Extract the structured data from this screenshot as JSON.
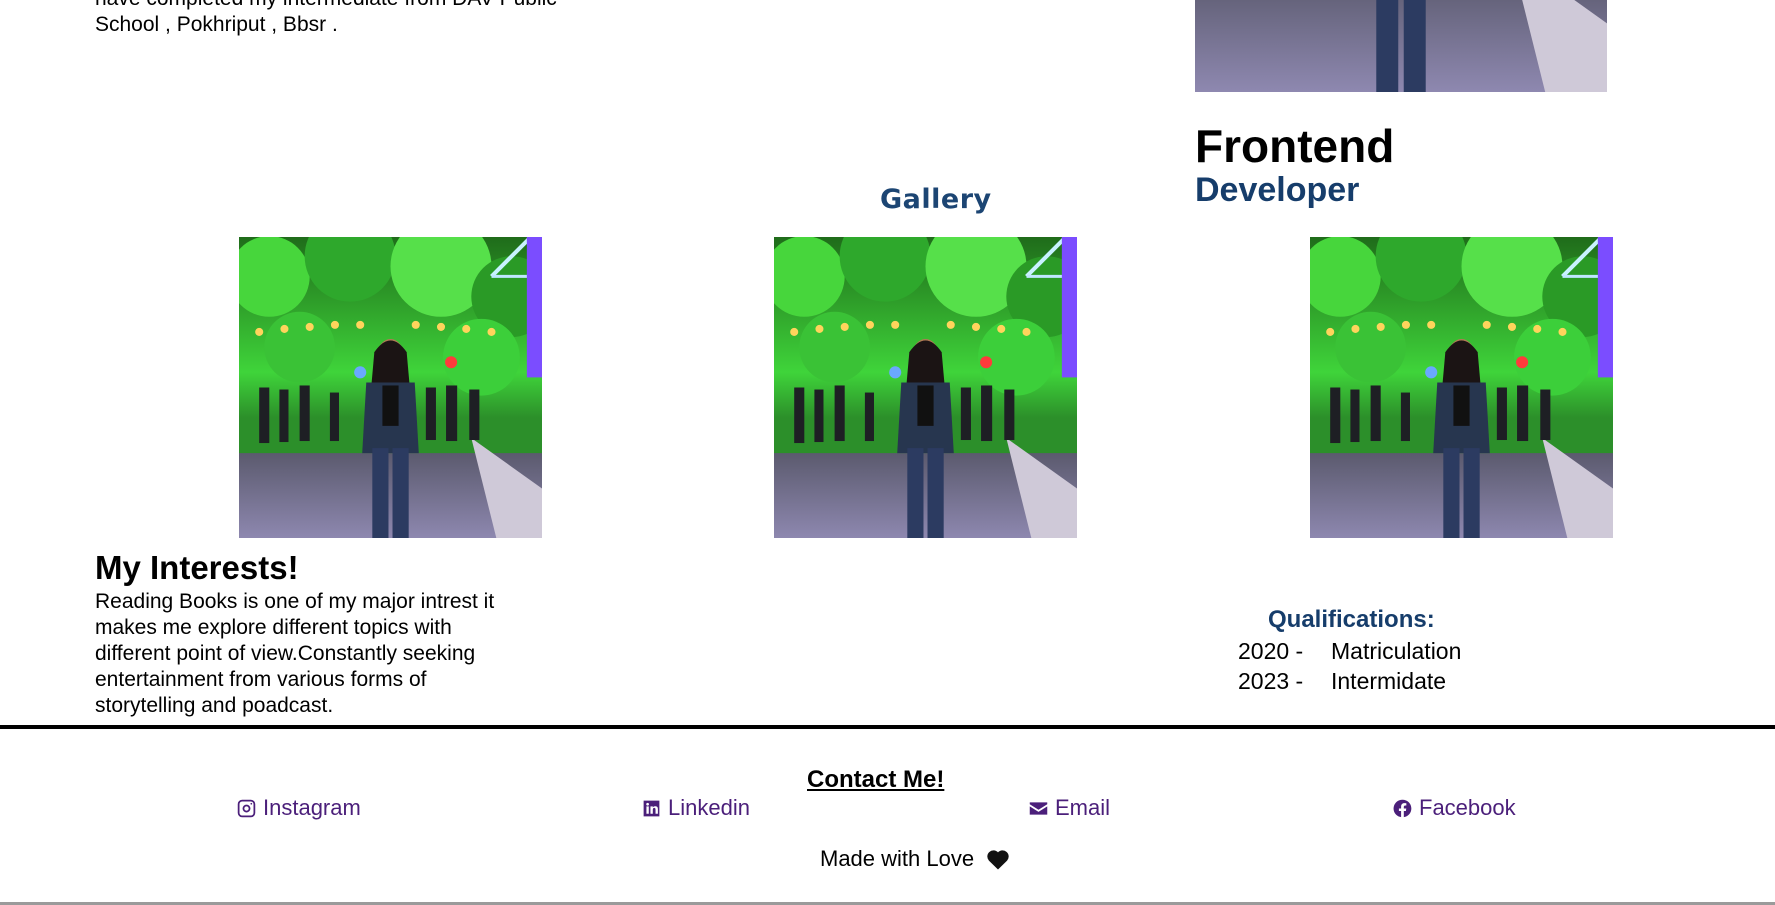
{
  "about": {
    "text": "have completed my intermediate from DAV Public School , Pokhriput , Bbsr ."
  },
  "hero": {
    "title_line1": "Frontend",
    "title_line2": "Developer",
    "photo_alt": "Portrait photo at night festival street"
  },
  "gallery": {
    "title": "Gallery",
    "photos": [
      {
        "alt": "Gallery photo 1"
      },
      {
        "alt": "Gallery photo 2"
      },
      {
        "alt": "Gallery photo 3"
      }
    ]
  },
  "interests": {
    "title": "My Interests!",
    "text": "Reading Books is one of my major intrest it makes me explore different topics with different point of view.Constantly seeking entertainment from various forms of storytelling and poadcast."
  },
  "qualifications": {
    "title": "Qualifications:",
    "rows": [
      {
        "year": "2020 -",
        "label": "Matriculation"
      },
      {
        "year": "2023 -",
        "label": "Intermidate"
      }
    ]
  },
  "footer": {
    "contact_title": "Contact Me!",
    "links": [
      {
        "label": "Instagram",
        "icon": "instagram-icon"
      },
      {
        "label": "Linkedin",
        "icon": "linkedin-icon"
      },
      {
        "label": "Email",
        "icon": "envelope-icon"
      },
      {
        "label": "Facebook",
        "icon": "facebook-icon"
      }
    ],
    "made_with": "Made with Love"
  },
  "colors": {
    "accent_blue": "#163d6b",
    "link_purple": "#4b1f7a"
  }
}
